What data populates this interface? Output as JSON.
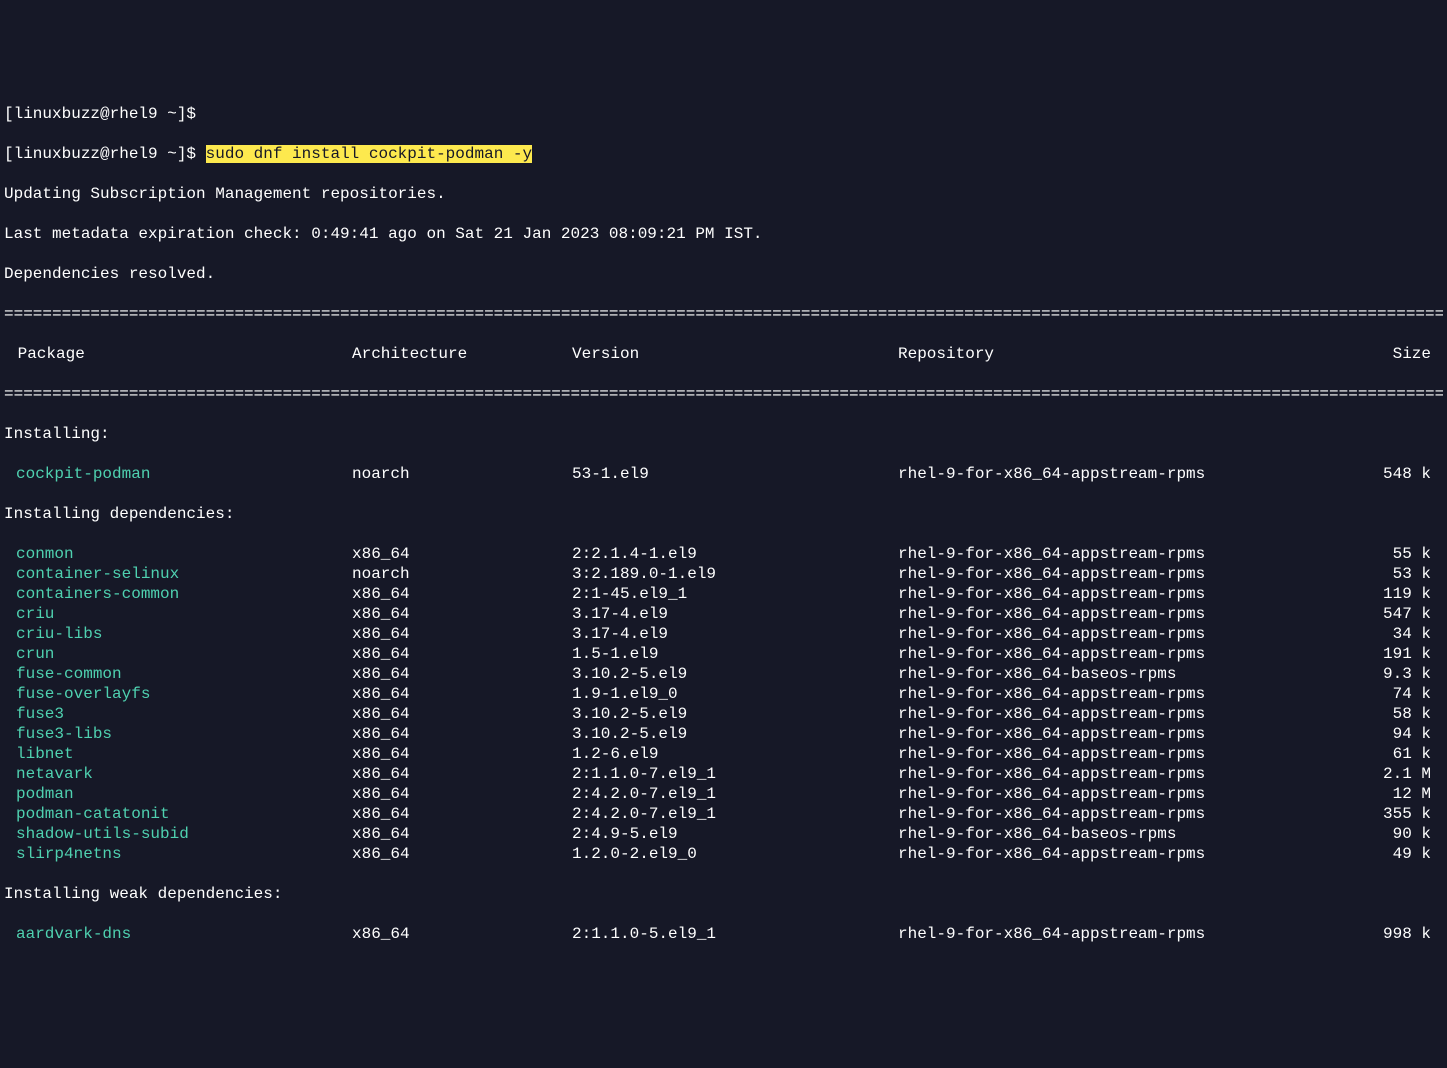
{
  "prompt1": "[linuxbuzz@rhel9 ~]$",
  "prompt2": "[linuxbuzz@rhel9 ~]$ ",
  "command": "sudo dnf install cockpit-podman -y",
  "output_lines": [
    "Updating Subscription Management repositories.",
    "Last metadata expiration check: 0:49:41 ago on Sat 21 Jan 2023 08:09:21 PM IST.",
    "Dependencies resolved."
  ],
  "headers": {
    "package": " Package",
    "architecture": "Architecture",
    "version": "Version",
    "repository": "Repository",
    "size": "Size"
  },
  "sections": {
    "installing": "Installing:",
    "installing_deps": "Installing dependencies:",
    "installing_weak": "Installing weak dependencies:"
  },
  "installing": [
    {
      "name": "cockpit-podman",
      "arch": "noarch",
      "version": "53-1.el9",
      "repo": "rhel-9-for-x86_64-appstream-rpms",
      "size": "548 k"
    }
  ],
  "dependencies": [
    {
      "name": "conmon",
      "arch": "x86_64",
      "version": "2:2.1.4-1.el9",
      "repo": "rhel-9-for-x86_64-appstream-rpms",
      "size": "55 k"
    },
    {
      "name": "container-selinux",
      "arch": "noarch",
      "version": "3:2.189.0-1.el9",
      "repo": "rhel-9-for-x86_64-appstream-rpms",
      "size": "53 k"
    },
    {
      "name": "containers-common",
      "arch": "x86_64",
      "version": "2:1-45.el9_1",
      "repo": "rhel-9-for-x86_64-appstream-rpms",
      "size": "119 k"
    },
    {
      "name": "criu",
      "arch": "x86_64",
      "version": "3.17-4.el9",
      "repo": "rhel-9-for-x86_64-appstream-rpms",
      "size": "547 k"
    },
    {
      "name": "criu-libs",
      "arch": "x86_64",
      "version": "3.17-4.el9",
      "repo": "rhel-9-for-x86_64-appstream-rpms",
      "size": "34 k"
    },
    {
      "name": "crun",
      "arch": "x86_64",
      "version": "1.5-1.el9",
      "repo": "rhel-9-for-x86_64-appstream-rpms",
      "size": "191 k"
    },
    {
      "name": "fuse-common",
      "arch": "x86_64",
      "version": "3.10.2-5.el9",
      "repo": "rhel-9-for-x86_64-baseos-rpms",
      "size": "9.3 k"
    },
    {
      "name": "fuse-overlayfs",
      "arch": "x86_64",
      "version": "1.9-1.el9_0",
      "repo": "rhel-9-for-x86_64-appstream-rpms",
      "size": "74 k"
    },
    {
      "name": "fuse3",
      "arch": "x86_64",
      "version": "3.10.2-5.el9",
      "repo": "rhel-9-for-x86_64-appstream-rpms",
      "size": "58 k"
    },
    {
      "name": "fuse3-libs",
      "arch": "x86_64",
      "version": "3.10.2-5.el9",
      "repo": "rhel-9-for-x86_64-appstream-rpms",
      "size": "94 k"
    },
    {
      "name": "libnet",
      "arch": "x86_64",
      "version": "1.2-6.el9",
      "repo": "rhel-9-for-x86_64-appstream-rpms",
      "size": "61 k"
    },
    {
      "name": "netavark",
      "arch": "x86_64",
      "version": "2:1.1.0-7.el9_1",
      "repo": "rhel-9-for-x86_64-appstream-rpms",
      "size": "2.1 M"
    },
    {
      "name": "podman",
      "arch": "x86_64",
      "version": "2:4.2.0-7.el9_1",
      "repo": "rhel-9-for-x86_64-appstream-rpms",
      "size": "12 M"
    },
    {
      "name": "podman-catatonit",
      "arch": "x86_64",
      "version": "2:4.2.0-7.el9_1",
      "repo": "rhel-9-for-x86_64-appstream-rpms",
      "size": "355 k"
    },
    {
      "name": "shadow-utils-subid",
      "arch": "x86_64",
      "version": "2:4.9-5.el9",
      "repo": "rhel-9-for-x86_64-baseos-rpms",
      "size": "90 k"
    },
    {
      "name": "slirp4netns",
      "arch": "x86_64",
      "version": "1.2.0-2.el9_0",
      "repo": "rhel-9-for-x86_64-appstream-rpms",
      "size": "49 k"
    }
  ],
  "weak_dependencies": [
    {
      "name": "aardvark-dns",
      "arch": "x86_64",
      "version": "2:1.1.0-5.el9_1",
      "repo": "rhel-9-for-x86_64-appstream-rpms",
      "size": "998 k"
    }
  ],
  "divider": "================================================================================================================================================================="
}
